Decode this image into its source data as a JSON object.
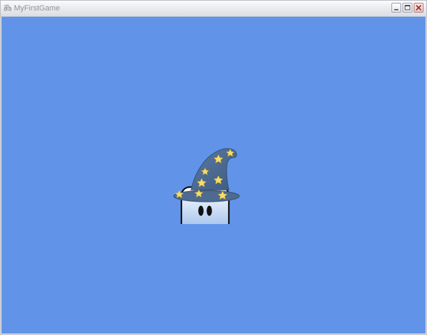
{
  "window": {
    "title": "MyFirstGame",
    "app_icon": "gamepad-icon",
    "controls": {
      "minimize": "minimize-icon",
      "maximize": "maximize-icon",
      "close": "close-icon"
    }
  },
  "game": {
    "background_color": "#6194e9",
    "sprite": {
      "name": "wizard-character",
      "hat_color": "#4d6a90",
      "star_color": "#f7dc6a",
      "body_gradient": [
        "#ffffff",
        "#8fb5e8"
      ]
    }
  }
}
